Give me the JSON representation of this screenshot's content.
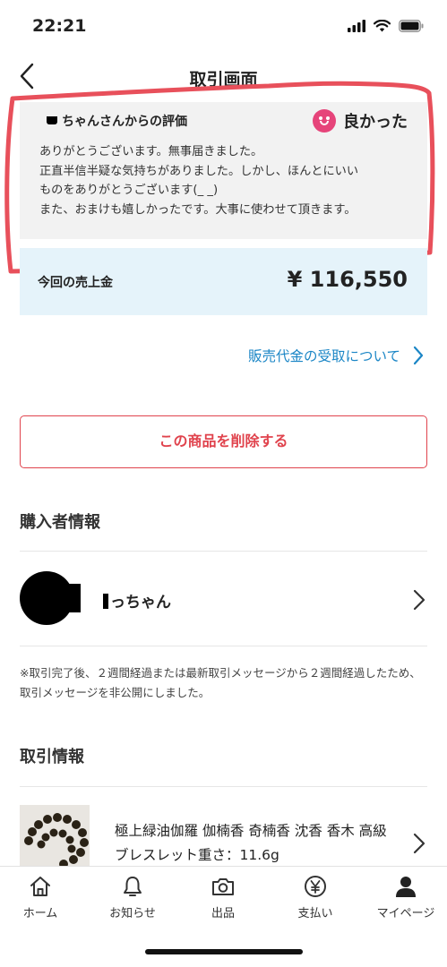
{
  "status_bar": {
    "time": "22:21"
  },
  "header": {
    "title": "取引画面"
  },
  "review": {
    "from": "ちゃんさんからの評価",
    "rating": "良かった",
    "lines": [
      "ありがとうございます。無事届きました。",
      "正直半信半疑な気持ちがありました。しかし、ほんとにいい",
      "ものをありがとうございます(_ _)",
      "また、おまけも嬉しかったです。大事に使わせて頂きます。"
    ]
  },
  "sales": {
    "label": "今回の売上金",
    "amount": "¥ 116,550"
  },
  "payment_link": "販売代金の受取について",
  "delete_button": "この商品を削除する",
  "buyer": {
    "section_title": "購入者情報",
    "name": "っちゃん"
  },
  "notice": "※取引完了後、２週間経過または最新取引メッセージから２週間経過したため、取引メッセージを非公開にしました。",
  "transaction": {
    "section_title": "取引情報",
    "item_name": "極上緑油伽羅 伽楠香 奇楠香 沈香 香木 高級ブレスレット重さ：11.6g"
  },
  "tabs": [
    {
      "label": "ホーム",
      "icon": "home-icon"
    },
    {
      "label": "お知らせ",
      "icon": "bell-icon"
    },
    {
      "label": "出品",
      "icon": "camera-icon"
    },
    {
      "label": "支払い",
      "icon": "yen-icon"
    },
    {
      "label": "マイページ",
      "icon": "person-icon"
    }
  ],
  "colors": {
    "accent": "#e0434d",
    "link": "#1b86c6",
    "highlight": "#e8505b",
    "sales_bg": "#e5f3fa"
  }
}
